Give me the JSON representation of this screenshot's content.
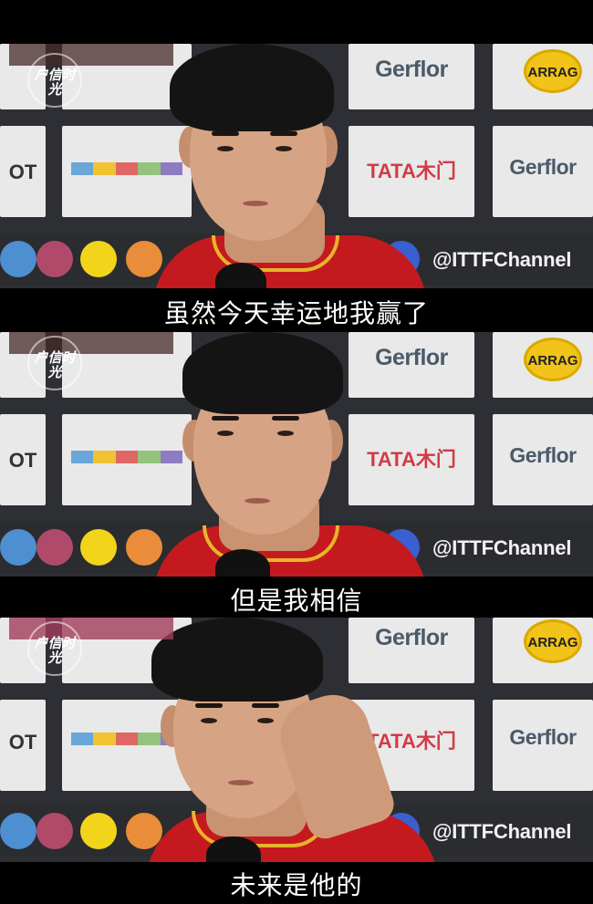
{
  "frames": [
    {
      "subtitle": "虽然今天幸运地我赢了",
      "watermark": "户信时光",
      "sponsors": {
        "gerflor": "Gerflor",
        "tata": "TATA木门",
        "arrag": "ARRAG",
        "ot": "OT",
        "itff": "@ITTFChannel"
      }
    },
    {
      "subtitle": "但是我相信",
      "watermark": "户信时光",
      "sponsors": {
        "gerflor": "Gerflor",
        "tata": "TATA木门",
        "arrag": "ARRAG",
        "ot": "OT",
        "itff": "@ITTFChannel"
      }
    },
    {
      "subtitle": "未来是他的",
      "watermark": "户信时光",
      "sponsors": {
        "gerflor": "Gerflor",
        "tata": "TATA木门",
        "arrag": "ARRAG",
        "ot": "OT",
        "itff": "@ITTFChannel"
      }
    }
  ],
  "colors": {
    "shirt": "#c41a1f",
    "collar_trim": "#e8b42a",
    "tata_red": "#d23b45",
    "arrag_yellow": "#f2c318",
    "subtitle_text": "#ffffff",
    "letterbox": "#000000"
  },
  "icons": [
    "twitter-icon",
    "instagram-icon",
    "snapchat-icon",
    "weibo-icon",
    "dailymotion-icon"
  ]
}
